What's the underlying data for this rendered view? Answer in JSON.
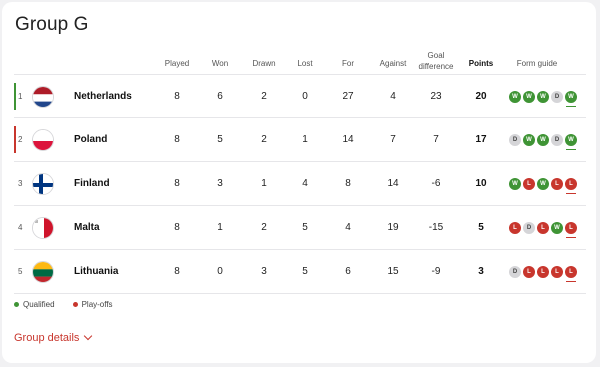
{
  "group": {
    "title": "Group G"
  },
  "headers": {
    "played": "Played",
    "won": "Won",
    "drawn": "Drawn",
    "lost": "Lost",
    "for": "For",
    "against": "Against",
    "goal_diff_line1": "Goal",
    "goal_diff_line2": "difference",
    "points": "Points",
    "form": "Form guide"
  },
  "rows": [
    {
      "pos": "1",
      "team": "Netherlands",
      "played": "8",
      "won": "6",
      "drawn": "2",
      "lost": "0",
      "for": "27",
      "against": "4",
      "gd": "23",
      "points": "20",
      "status": "qualified",
      "flag": "netherlands-flag",
      "form": [
        "W",
        "W",
        "W",
        "D",
        "W"
      ]
    },
    {
      "pos": "2",
      "team": "Poland",
      "played": "8",
      "won": "5",
      "drawn": "2",
      "lost": "1",
      "for": "14",
      "against": "7",
      "gd": "7",
      "points": "17",
      "status": "play-offs",
      "flag": "poland-flag",
      "form": [
        "D",
        "W",
        "W",
        "D",
        "W"
      ]
    },
    {
      "pos": "3",
      "team": "Finland",
      "played": "8",
      "won": "3",
      "drawn": "1",
      "lost": "4",
      "for": "8",
      "against": "14",
      "gd": "-6",
      "points": "10",
      "status": "none",
      "flag": "finland-flag",
      "form": [
        "W",
        "L",
        "W",
        "L",
        "L"
      ]
    },
    {
      "pos": "4",
      "team": "Malta",
      "played": "8",
      "won": "1",
      "drawn": "2",
      "lost": "5",
      "for": "4",
      "against": "19",
      "gd": "-15",
      "points": "5",
      "status": "none",
      "flag": "malta-flag",
      "form": [
        "L",
        "D",
        "L",
        "W",
        "L"
      ]
    },
    {
      "pos": "5",
      "team": "Lithuania",
      "played": "8",
      "won": "0",
      "drawn": "3",
      "lost": "5",
      "for": "6",
      "against": "15",
      "gd": "-9",
      "points": "3",
      "status": "none",
      "flag": "lithuania-flag",
      "form": [
        "D",
        "L",
        "L",
        "L",
        "L"
      ]
    }
  ],
  "legend": {
    "qualified": "Qualified",
    "playoffs": "Play-offs"
  },
  "colors": {
    "qualified": "#3f9435",
    "playoffs": "#c8362d",
    "draw": "#d5d5d8"
  },
  "footer": {
    "group_details": "Group details"
  }
}
